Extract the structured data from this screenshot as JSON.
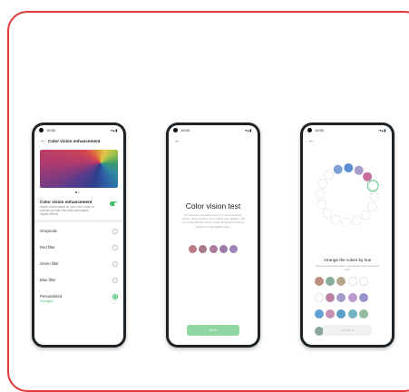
{
  "phone1": {
    "time": "19:50",
    "status_icons": "▾▴▮",
    "title": "Color vision enhancement",
    "feature_title": "Color vision enhancement",
    "feature_desc": "Adjust colors based on your color vision to provide you with the most comfortable display effects.",
    "options": [
      {
        "label": "Grayscale",
        "selected": false
      },
      {
        "label": "Red filter",
        "selected": false
      },
      {
        "label": "Green filter",
        "selected": false
      },
      {
        "label": "Blue filter",
        "selected": false
      },
      {
        "label": "Personalized",
        "sub": "Test again",
        "selected": true
      }
    ]
  },
  "phone2": {
    "time": "19:50",
    "status_icons": "▾▴▮",
    "title": "Color vision test",
    "description": "Do the test in a well-lit room for more accurate results. \"Eye comfort\" and \"Adjust tone display\" will be turned off and screen color temperature will be restored to the default value.",
    "swatches": [
      "#b87b86",
      "#a8798b",
      "#a8799a",
      "#9d7ba5",
      "#9f83b4"
    ],
    "start_label": "Start"
  },
  "phone3": {
    "time": "19:50",
    "status_icons": "▾▴▮",
    "ring_colors": [
      "#7e9fd6",
      "#5c8ed3",
      "#a69bcc",
      "#c86fa0",
      null,
      null,
      null,
      null,
      null,
      null,
      null,
      null,
      null,
      null,
      null,
      null
    ],
    "arrange_title": "Arrange the colors by hue",
    "description": "Tap the color that looks most similar to the previous color.",
    "grid_colors": [
      "#b9907d",
      "#87ad9b",
      "#b7a88c",
      null,
      null,
      null,
      "#bc7fa2",
      "#a59bc9",
      "#bd9bd0",
      "#9a92cc",
      "#61a0d7",
      "#c68fb6",
      "#5c9fc8",
      "#74b3c4",
      "#93bca0",
      "#8aa69e",
      "#66a2c7",
      "#9cd4b4"
    ],
    "confirm_label": "Confirm"
  }
}
